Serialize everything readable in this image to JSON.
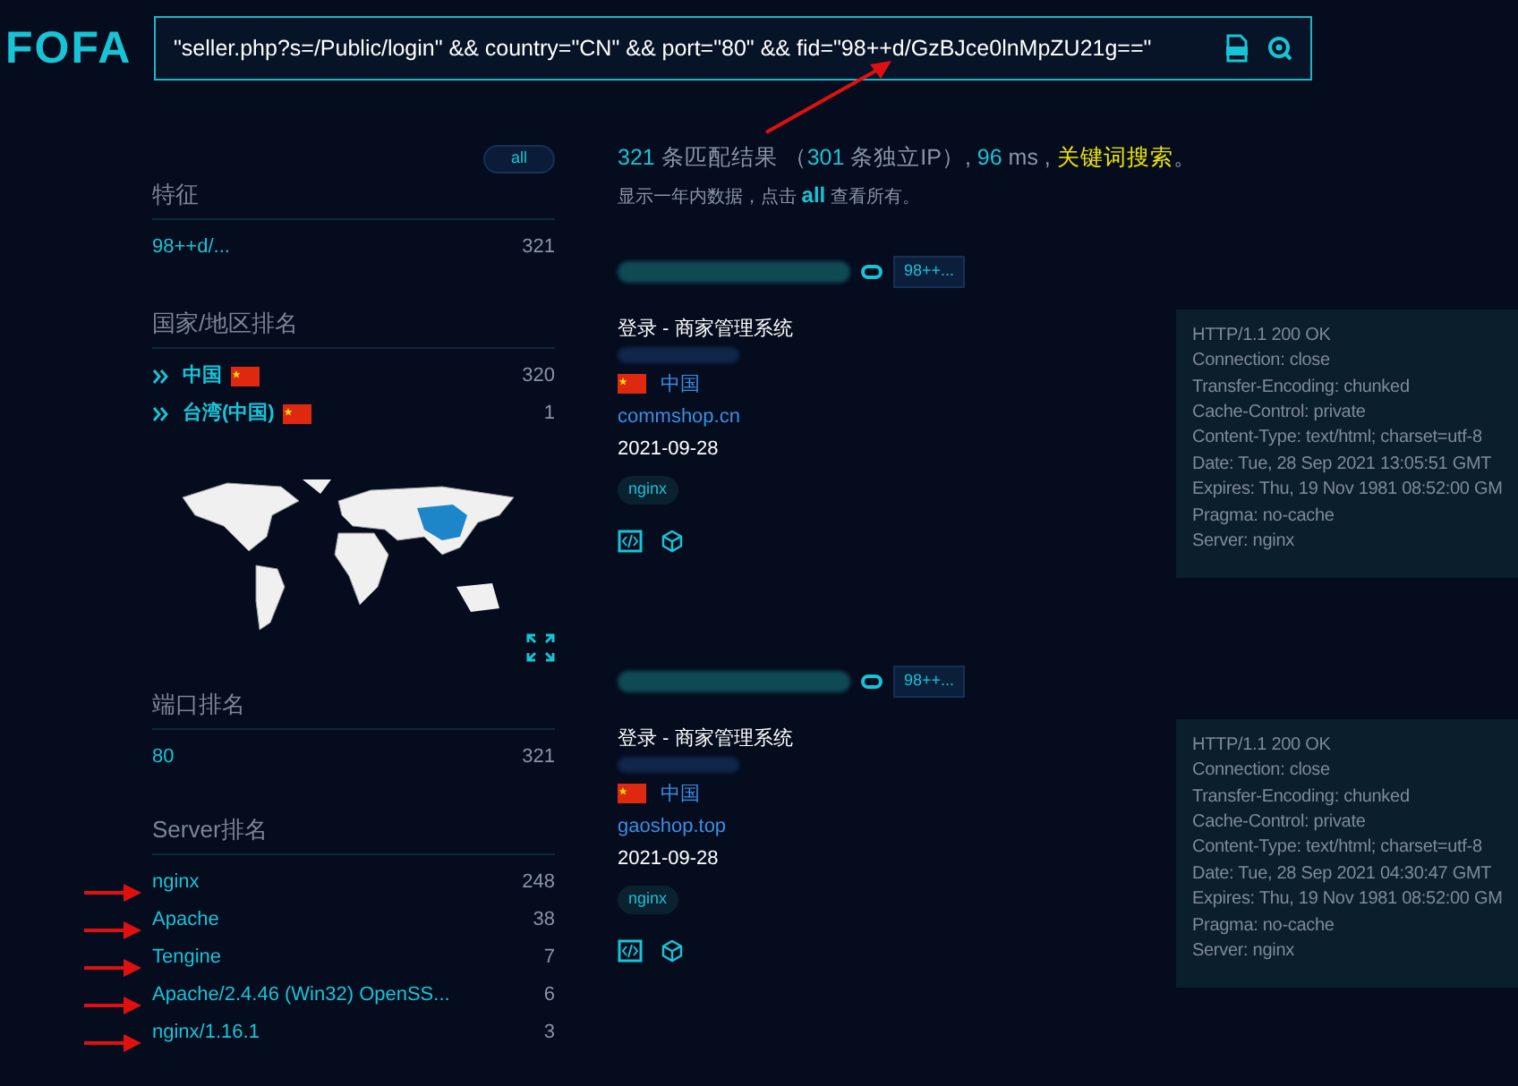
{
  "logo": "FOFA",
  "search": {
    "value": "\"seller.php?s=/Public/login\" && country=\"CN\" && port=\"80\" && fid=\"98++d/GzBJce0lnMpZU21g==\""
  },
  "summary": [
    {
      "kind": "number",
      "text": "321"
    },
    {
      "kind": "plain",
      "text": " 条匹配结果 （"
    },
    {
      "kind": "number",
      "text": "301"
    },
    {
      "kind": "plain",
      "text": " 条独立IP）, "
    },
    {
      "kind": "number",
      "text": "96"
    },
    {
      "kind": "plain",
      "text": " ms , "
    },
    {
      "kind": "highlight",
      "text": "关键词搜索"
    },
    {
      "kind": "plain",
      "text": "。"
    }
  ],
  "notice": [
    {
      "kind": "plain",
      "text": "显示一年内数据，点击 "
    },
    {
      "kind": "link",
      "text": "all"
    },
    {
      "kind": "plain",
      "text": " 查看所有。"
    }
  ],
  "sidebar": {
    "all_button": "all",
    "sections": [
      {
        "title": "特征",
        "kind": "plain",
        "items": [
          {
            "label": "98++d/...",
            "count": "321"
          }
        ]
      },
      {
        "title": "国家/地区排名",
        "kind": "country",
        "items": [
          {
            "label": "中国",
            "count": "320"
          },
          {
            "label": "台湾(中国)",
            "count": "1"
          }
        ]
      },
      {
        "title": "端口排名",
        "kind": "plain",
        "items": [
          {
            "label": "80",
            "count": "321"
          }
        ]
      },
      {
        "title": "Server排名",
        "kind": "plain",
        "items": [
          {
            "label": "nginx",
            "count": "248"
          },
          {
            "label": "Apache",
            "count": "38"
          },
          {
            "label": "Tengine",
            "count": "7"
          },
          {
            "label": "Apache/2.4.46 (Win32) OpenSS...",
            "count": "6"
          },
          {
            "label": "nginx/1.16.1",
            "count": "3"
          }
        ]
      }
    ]
  },
  "results": [
    {
      "fid_tag": "98++...",
      "title": "登录 - 商家管理系统",
      "country": "中国",
      "domain": "commshop.cn",
      "date": "2021-09-28",
      "tags": [
        "nginx"
      ],
      "headers": [
        "HTTP/1.1 200 OK",
        "Connection: close",
        "Transfer-Encoding: chunked",
        "Cache-Control: private",
        "Content-Type: text/html; charset=utf-8",
        "Date: Tue, 28 Sep 2021 13:05:51 GMT",
        "Expires: Thu, 19 Nov 1981 08:52:00 GM",
        "Pragma: no-cache",
        "Server: nginx"
      ]
    },
    {
      "fid_tag": "98++...",
      "title": "登录 - 商家管理系统",
      "country": "中国",
      "domain": "gaoshop.top",
      "date": "2021-09-28",
      "tags": [
        "nginx"
      ],
      "headers": [
        "HTTP/1.1 200 OK",
        "Connection: close",
        "Transfer-Encoding: chunked",
        "Cache-Control: private",
        "Content-Type: text/html; charset=utf-8",
        "Date: Tue, 28 Sep 2021 04:30:47 GMT",
        "Expires: Thu, 19 Nov 1981 08:52:00 GM",
        "Pragma: no-cache",
        "Server: nginx"
      ]
    }
  ]
}
